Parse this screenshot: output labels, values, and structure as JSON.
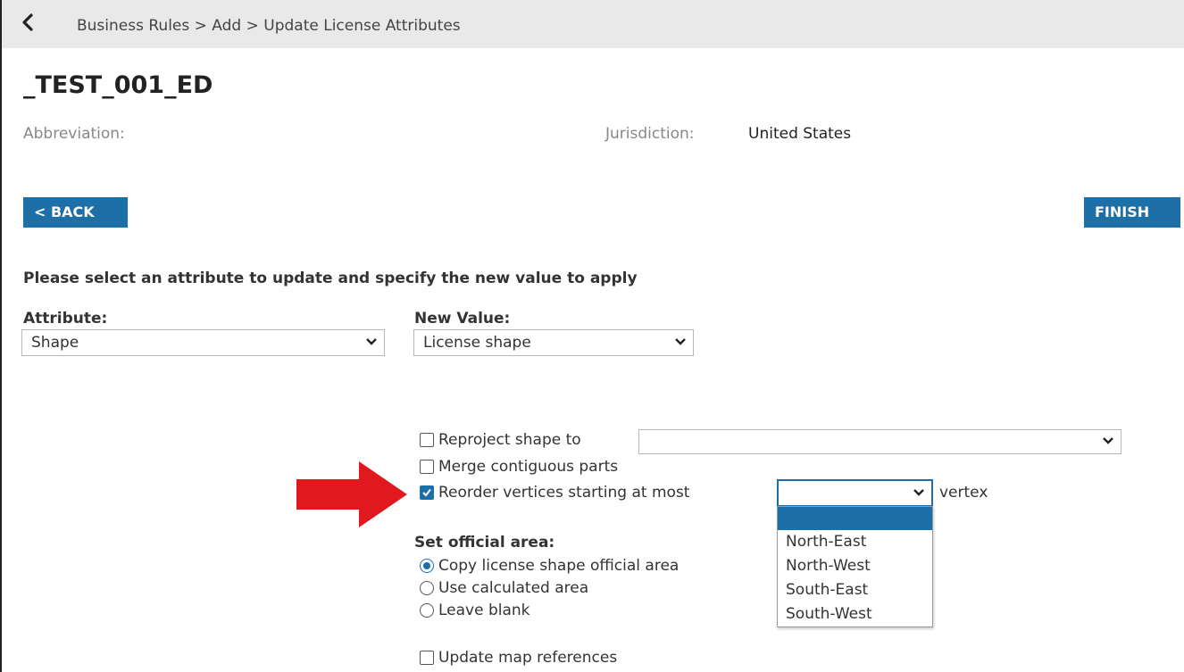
{
  "header": {
    "back_icon": "chevron-left-icon",
    "breadcrumb": "Business Rules > Add > Update License Attributes"
  },
  "page": {
    "title": "_TEST_001_ED",
    "abbreviation_label": "Abbreviation:",
    "jurisdiction_label": "Jurisdiction:",
    "jurisdiction_value": "United States"
  },
  "buttons": {
    "back_label": "< BACK",
    "finish_label": "FINISH"
  },
  "form": {
    "instruction": "Please select an attribute to update and specify the new value to apply",
    "attribute_label": "Attribute:",
    "attribute_value": "Shape",
    "new_value_label": "New Value:",
    "new_value_value": "License shape"
  },
  "options": {
    "reproject_label": "Reproject shape to",
    "reproject_checked": false,
    "reproject_value": "",
    "merge_label": "Merge contiguous parts",
    "merge_checked": false,
    "reorder_label": "Reorder vertices starting at most",
    "reorder_checked": true,
    "reorder_value": "",
    "reorder_suffix": "vertex",
    "reorder_options": [
      "",
      "North-East",
      "North-West",
      "South-East",
      "South-West"
    ]
  },
  "official_area": {
    "label": "Set official area:",
    "options": [
      "Copy license shape official area",
      "Use calculated area",
      "Leave blank"
    ],
    "selected": "Copy license shape official area"
  },
  "map_refs": {
    "label": "Update map references",
    "checked": false
  },
  "colors": {
    "accent": "#1d6fa8",
    "annotation_arrow": "#e0191e"
  }
}
